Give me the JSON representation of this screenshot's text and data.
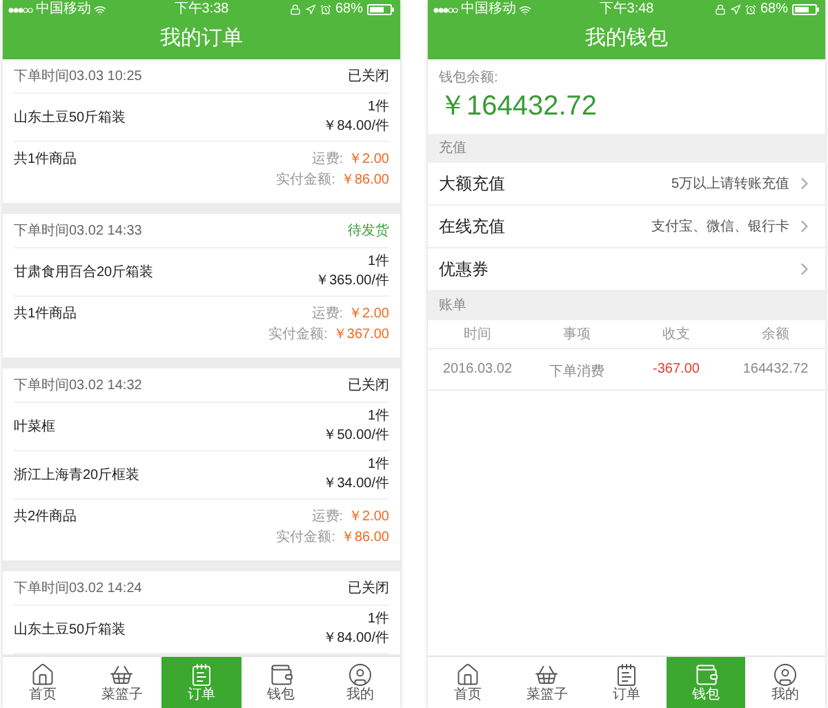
{
  "screens": [
    {
      "kind": "orders",
      "status_bar": {
        "carrier": "中国移动",
        "time": "下午3:38",
        "battery": "68%"
      },
      "title": "我的订单",
      "orders": [
        {
          "time": "下单时间03.03 10:25",
          "status": "已关闭",
          "color": "#222222",
          "items": [
            {
              "name": "山东土豆50斤箱装",
              "qty": "1件",
              "price": "￥84.00/件"
            }
          ],
          "summary": {
            "count": "共1件商品",
            "shipping_label": "运费:",
            "shipping": "￥2.00",
            "paid_label": "实付金额:",
            "paid": "￥86.00"
          }
        },
        {
          "time": "下单时间03.02 14:33",
          "status": "待发货",
          "color": "#3a9a35",
          "items": [
            {
              "name": "甘肃食用百合20斤箱装",
              "qty": "1件",
              "price": "￥365.00/件"
            }
          ],
          "summary": {
            "count": "共1件商品",
            "shipping_label": "运费:",
            "shipping": "￥2.00",
            "paid_label": "实付金额:",
            "paid": "￥367.00"
          }
        },
        {
          "time": "下单时间03.02 14:32",
          "status": "已关闭",
          "color": "#222222",
          "items": [
            {
              "name": "叶菜框",
              "qty": "1件",
              "price": "￥50.00/件"
            },
            {
              "name": "浙江上海青20斤框装",
              "qty": "1件",
              "price": "￥34.00/件"
            }
          ],
          "summary": {
            "count": "共2件商品",
            "shipping_label": "运费:",
            "shipping": "￥2.00",
            "paid_label": "实付金额:",
            "paid": "￥86.00"
          }
        },
        {
          "time": "下单时间03.02 14:24",
          "status": "已关闭",
          "color": "#222222",
          "items": [
            {
              "name": "山东土豆50斤箱装",
              "qty": "1件",
              "price": "￥84.00/件"
            }
          ]
        }
      ],
      "tabs": [
        {
          "label": "首页",
          "selected": false
        },
        {
          "label": "菜篮子",
          "selected": false
        },
        {
          "label": "订单",
          "selected": true
        },
        {
          "label": "钱包",
          "selected": false
        },
        {
          "label": "我的",
          "selected": false
        }
      ]
    },
    {
      "kind": "wallet",
      "status_bar": {
        "carrier": "中国移动",
        "time": "下午3:48",
        "battery": "68%"
      },
      "title": "我的钱包",
      "balance_label": "钱包余额:",
      "balance": "￥164432.72",
      "recharge_header": "充值",
      "rows": [
        {
          "label": "大额充值",
          "detail": "5万以上请转账充值"
        },
        {
          "label": "在线充值",
          "detail": "支付宝、微信、银行卡"
        },
        {
          "label": "优惠券"
        }
      ],
      "bill_header": "账单",
      "bill_columns": [
        "时间",
        "事项",
        "收支",
        "余额"
      ],
      "bill_rows": [
        {
          "time": "2016.03.02",
          "item": "下单消费",
          "amount": "-367.00",
          "color": "#e23b2e",
          "balance": "164432.72"
        }
      ],
      "tabs": [
        {
          "label": "首页",
          "selected": false
        },
        {
          "label": "菜篮子",
          "selected": false
        },
        {
          "label": "订单",
          "selected": false
        },
        {
          "label": "钱包",
          "selected": true
        },
        {
          "label": "我的",
          "selected": false
        }
      ]
    }
  ]
}
